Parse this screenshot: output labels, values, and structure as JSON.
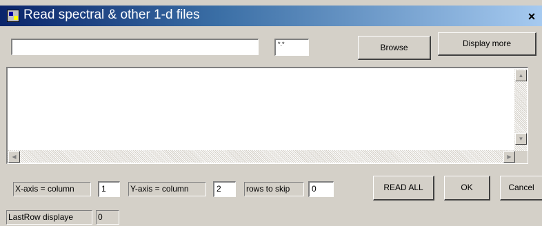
{
  "window": {
    "title": "Read spectral & other 1-d files",
    "close_label": "×"
  },
  "file": {
    "path_value": "",
    "filter_value": "*.*"
  },
  "buttons": {
    "browse": "Browse",
    "display_more": "Display more",
    "read_all": "READ ALL",
    "ok": "OK",
    "cancel": "Cancel"
  },
  "text_area": {
    "content": ""
  },
  "params": {
    "x_axis_label": "X-axis = column",
    "x_axis_value": "1",
    "y_axis_label": "Y-axis = column",
    "y_axis_value": "2",
    "rows_skip_label": "rows to skip",
    "rows_skip_value": "0",
    "last_row_label": "LastRow displaye",
    "last_row_value": "0"
  },
  "scroll_glyphs": {
    "up": "▲",
    "down": "▼",
    "left": "◀",
    "right": "▶"
  },
  "colors": {
    "title_start": "#0a246a",
    "title_end": "#a6caf0",
    "face": "#d4d0c8"
  }
}
